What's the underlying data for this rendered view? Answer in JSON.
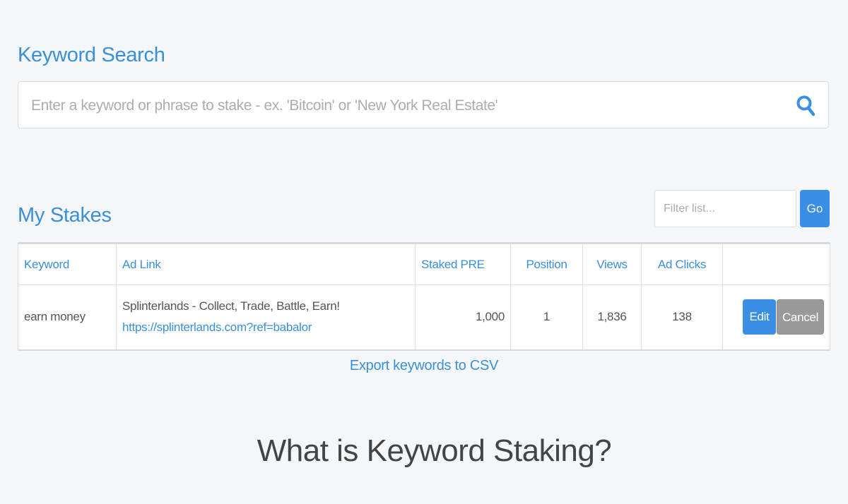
{
  "keyword_search": {
    "title": "Keyword Search",
    "placeholder": "Enter a keyword or phrase to stake - ex. 'Bitcoin' or 'New York Real Estate'",
    "value": ""
  },
  "my_stakes": {
    "title": "My Stakes",
    "filter_placeholder": "Filter list...",
    "go_label": "Go",
    "columns": {
      "keyword": "Keyword",
      "ad_link": "Ad Link",
      "staked_pre": "Staked PRE",
      "position": "Position",
      "views": "Views",
      "ad_clicks": "Ad Clicks"
    },
    "rows": [
      {
        "keyword": "earn money",
        "ad_title": "Splinterlands - Collect, Trade, Battle, Earn!",
        "ad_url": "https://splinterlands.com?ref=babalor",
        "staked_pre": "1,000",
        "position": "1",
        "views": "1,836",
        "ad_clicks": "138",
        "edit_label": "Edit",
        "cancel_label": "Cancel"
      }
    ],
    "export_label": "Export keywords to CSV"
  },
  "info": {
    "heading": "What is Keyword Staking?"
  },
  "icons": {
    "search": "search-icon"
  },
  "colors": {
    "accent": "#3b8fd9",
    "button_primary": "#3a8ee6",
    "button_secondary": "#999999",
    "background": "#f4f7fa"
  }
}
